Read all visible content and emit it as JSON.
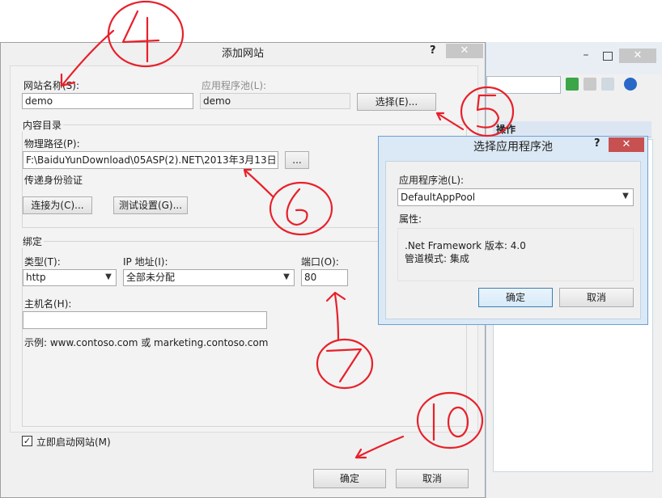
{
  "main_dialog": {
    "title": "添加网站",
    "help_label": "?",
    "close_label": "✕",
    "site_name_label": "网站名称(S):",
    "site_name_value": "demo",
    "app_pool_label": "应用程序池(L):",
    "app_pool_value": "demo",
    "select_button": "选择(E)...",
    "content_group": "内容目录",
    "physical_path_label": "物理路径(P):",
    "physical_path_value": "F:\\BaiduYunDownload\\05ASP(2).NET\\2013年3月13日",
    "browse_button": "...",
    "passthrough_label": "传递身份验证",
    "connect_as_button": "连接为(C)...",
    "test_settings_button": "测试设置(G)...",
    "binding_group": "绑定",
    "type_label": "类型(T):",
    "type_value": "http",
    "ip_label": "IP 地址(I):",
    "ip_value": "全部未分配",
    "port_label": "端口(O):",
    "port_value": "80",
    "hostname_label": "主机名(H):",
    "hostname_value": "",
    "example_text": "示例: www.contoso.com 或 marketing.contoso.com",
    "start_now_label": "立即启动网站(M)",
    "start_now_checked": true,
    "ok_button": "确定",
    "cancel_button": "取消"
  },
  "sub_dialog": {
    "title": "选择应用程序池",
    "help_label": "?",
    "close_label": "✕",
    "app_pool_label": "应用程序池(L):",
    "app_pool_value": "DefaultAppPool",
    "properties_label": "属性:",
    "framework_line": ".Net Framework 版本: 4.0",
    "pipeline_line": "管道模式: 集成",
    "ok_button": "确定",
    "cancel_button": "取消"
  },
  "background_window": {
    "actions_header": "操作",
    "minimize_label": "–",
    "close_label": "✕"
  },
  "colors": {
    "annotation": "#e8202a",
    "sub_dialog_frame": "#6da0d6",
    "close_hover": "#c75050"
  }
}
